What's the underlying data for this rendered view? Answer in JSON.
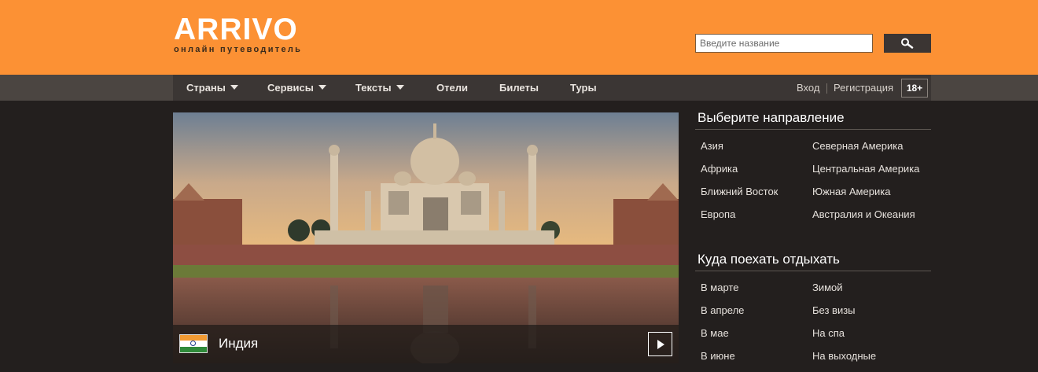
{
  "header": {
    "logo": "ARRIVO",
    "tagline": "онлайн путеводитель",
    "search_placeholder": "Введите название",
    "search_icon": "search-icon"
  },
  "nav": {
    "items": [
      {
        "label": "Страны",
        "dropdown": true
      },
      {
        "label": "Сервисы",
        "dropdown": true
      },
      {
        "label": "Тексты",
        "dropdown": true
      },
      {
        "label": "Отели",
        "dropdown": false
      },
      {
        "label": "Билеты",
        "dropdown": false
      },
      {
        "label": "Туры",
        "dropdown": false
      }
    ],
    "login": "Вход",
    "register": "Регистрация",
    "age": "18+"
  },
  "slider": {
    "caption": "Индия",
    "flag_icon": "india-flag-icon",
    "next_icon": "play-arrow-icon"
  },
  "destinations": {
    "title": "Выберите направление",
    "col1": [
      "Азия",
      "Африка",
      "Ближний Восток",
      "Европа"
    ],
    "col2": [
      "Северная Америка",
      "Центральная Америка",
      "Южная Америка",
      "Австралия и Океания"
    ]
  },
  "holidays": {
    "title": "Куда поехать отдыхать",
    "col1": [
      "В марте",
      "В апреле",
      "В мае",
      "В июне"
    ],
    "col2": [
      "Зимой",
      "Без визы",
      "На спа",
      "На выходные"
    ]
  },
  "colors": {
    "brand_orange": "#fc9134",
    "nav_bg": "#3b3634",
    "page_bg": "#231f1e"
  }
}
